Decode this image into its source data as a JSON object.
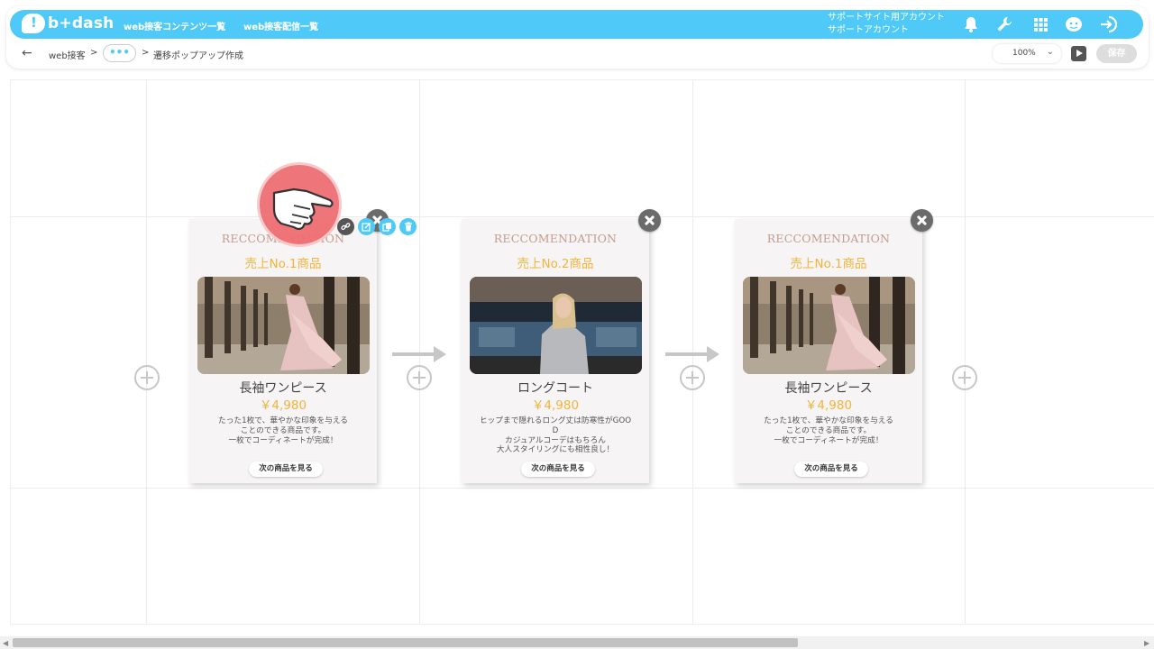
{
  "header": {
    "logo_text": "b+dash",
    "nav": [
      "web接客コンテンツ一覧",
      "web接客配信一覧"
    ],
    "account_line1": "サポートサイト用アカウント",
    "account_line2": "サポートアカウント",
    "icons": [
      "bell-icon",
      "wrench-icon",
      "apps-grid-icon",
      "support-face-icon",
      "logout-icon"
    ]
  },
  "breadcrumb": {
    "back": "←",
    "root": "web接客",
    "sep1": ">",
    "ellipsis": "•••",
    "sep2": ">",
    "current": "遷移ポップアップ作成"
  },
  "toolbar": {
    "zoom": "100%",
    "save_label": "保存"
  },
  "cards": [
    {
      "heading": "RECCOMENDATION",
      "rank": "売上No.1商品",
      "product_name": "長袖ワンピース",
      "price": "￥4,980",
      "description": [
        "たった1枚で、華やかな印象を与える",
        "ことのできる商品です。",
        "一枚でコーディネートが完成！"
      ],
      "next_label": "次の商品を見る"
    },
    {
      "heading": "RECCOMENDATION",
      "rank": "売上No.2商品",
      "product_name": "ロングコート",
      "price": "￥4,980",
      "description": [
        "ヒップまで隠れるロング丈は防寒性がGOO",
        "D",
        "カジュアルコーデはもちろん",
        "大人スタイリングにも相性良し！"
      ],
      "next_label": "次の商品を見る"
    },
    {
      "heading": "RECCOMENDATION",
      "rank": "売上No.1商品",
      "product_name": "長袖ワンピース",
      "price": "￥4,980",
      "description": [
        "たった1枚で、華やかな印象を与える",
        "ことのできる商品です。",
        "一枚でコーディネートが完成！"
      ],
      "next_label": "次の商品を見る"
    }
  ],
  "card_tools": [
    "link-icon",
    "edit-icon",
    "copy-icon",
    "trash-icon"
  ],
  "colors": {
    "brand": "#4fc9f7",
    "accent_price": "#f3b33a",
    "heading": "#c49c8e",
    "cursor": "#ee6e72"
  }
}
